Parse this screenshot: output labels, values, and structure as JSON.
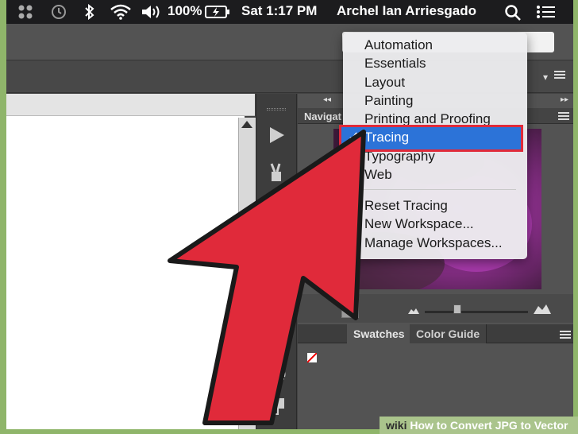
{
  "menubar": {
    "battery": "100%",
    "clock": "Sat 1:17 PM",
    "user": "Archel Ian Arriesgado"
  },
  "panels": {
    "navigator_tab": "Navigat",
    "swatches_tab": "Swatches",
    "color_guide_tab": "Color Guide"
  },
  "workspace_menu": {
    "items": [
      "Automation",
      "Essentials",
      "Layout",
      "Painting",
      "Printing and Proofing"
    ],
    "selected": "Tracing",
    "check": "✓",
    "items_after": [
      "Typography",
      "Web"
    ],
    "actions": [
      "Reset Tracing",
      "New Workspace...",
      "Manage Workspaces..."
    ]
  },
  "footer": {
    "site": "wiki",
    "title": "How to Convert JPG to Vector"
  },
  "colors": {
    "highlight": "#2c73d8",
    "annotation": "#e02a3a",
    "arrow": "#e02a3a"
  },
  "icons": [
    "grid-icon",
    "time-machine-icon",
    "wifi-icon",
    "volume-icon",
    "battery-icon",
    "search-icon",
    "list-icon",
    "play-icon",
    "brush-icon",
    "align-icon",
    "circle-icon",
    "layers-icon",
    "panel-menu-icon"
  ]
}
